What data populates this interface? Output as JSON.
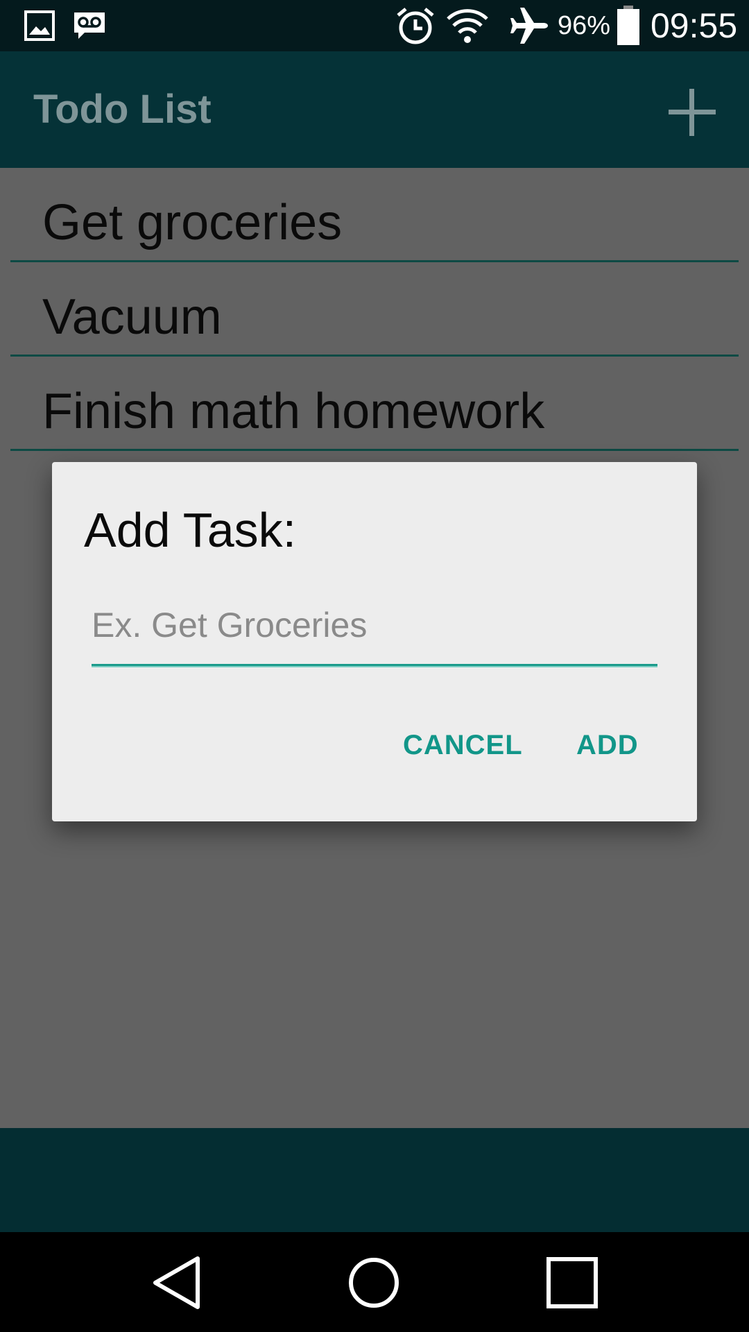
{
  "status_bar": {
    "battery_text": "96%",
    "time": "09:55",
    "icons": [
      "image-icon",
      "voicemail-icon",
      "alarm-icon",
      "wifi-icon",
      "airplane-icon",
      "battery-icon"
    ]
  },
  "app_bar": {
    "title": "Todo List",
    "add_icon": "plus-icon"
  },
  "tasks": [
    {
      "label": "Get groceries"
    },
    {
      "label": "Vacuum"
    },
    {
      "label": "Finish math homework"
    }
  ],
  "dialog": {
    "title": "Add Task:",
    "input_value": "",
    "input_placeholder": "Ex. Get Groceries",
    "cancel_label": "CANCEL",
    "add_label": "ADD"
  },
  "nav_bar": {
    "icons": [
      "back-icon",
      "home-icon",
      "recents-icon"
    ]
  },
  "colors": {
    "status_bar": "#041a1d",
    "app_bar": "#053237",
    "accent": "#129689",
    "scrim_background": "#626262",
    "dialog_background": "#ededed"
  }
}
